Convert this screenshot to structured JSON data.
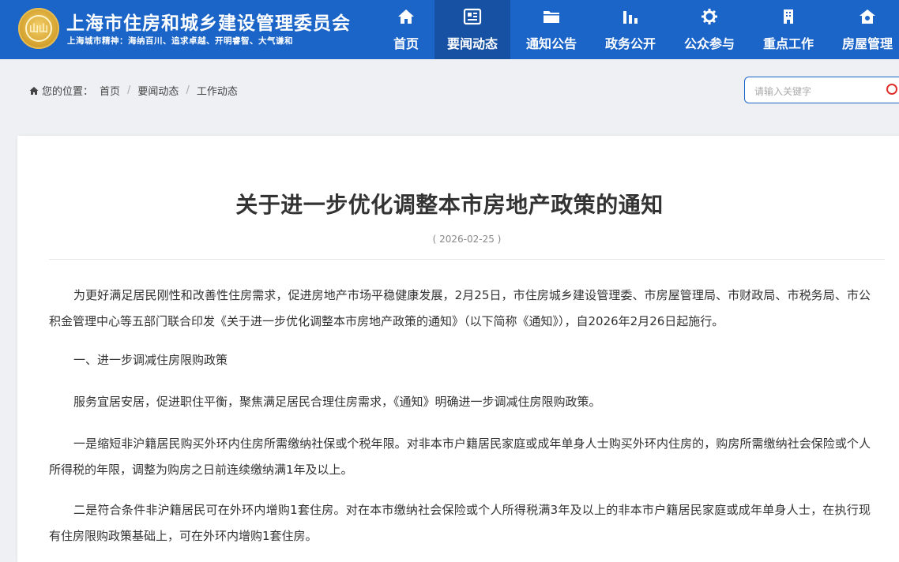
{
  "header": {
    "title": "上海市住房和城乡建设管理委员会",
    "subtitle": "上海城市精神：海纳百川、追求卓越、开明睿智、大气谦和",
    "logo_text": "山山"
  },
  "nav": [
    {
      "label": "首页",
      "icon": "home-icon"
    },
    {
      "label": "要闻动态",
      "icon": "news-icon",
      "active": true
    },
    {
      "label": "通知公告",
      "icon": "folder-icon"
    },
    {
      "label": "政务公开",
      "icon": "chart-icon"
    },
    {
      "label": "公众参与",
      "icon": "gear-icon"
    },
    {
      "label": "重点工作",
      "icon": "building-icon"
    },
    {
      "label": "房屋管理",
      "icon": "house-icon"
    }
  ],
  "breadcrumb": {
    "prefix": "您的位置：",
    "items": [
      "首页",
      "要闻动态",
      "工作动态"
    ]
  },
  "search": {
    "placeholder": "请输入关键字"
  },
  "article": {
    "title": "关于进一步优化调整本市房地产政策的通知",
    "date": "( 2026-02-25 )",
    "paragraphs": [
      "为更好满足居民刚性和改善性住房需求，促进房地产市场平稳健康发展，2月25日，市住房城乡建设管理委、市房屋管理局、市财政局、市税务局、市公积金管理中心等五部门联合印发《关于进一步优化调整本市房地产政策的通知》（以下简称《通知》），自2026年2月26日起施行。",
      "一、进一步调减住房限购政策",
      "服务宜居安居，促进职住平衡，聚焦满足居民合理住房需求，《通知》明确进一步调减住房限购政策。",
      "一是缩短非沪籍居民购买外环内住房所需缴纳社保或个税年限。对非本市户籍居民家庭或成年单身人士购买外环内住房的，购房所需缴纳社会保险或个人所得税的年限，调整为购房之日前连续缴纳满1年及以上。",
      "二是符合条件非沪籍居民可在外环内增购1套住房。对在本市缴纳社会保险或个人所得税满3年及以上的非本市户籍居民家庭或成年单身人士，在执行现有住房限购政策基础上，可在外环内增购1套住房。"
    ]
  }
}
